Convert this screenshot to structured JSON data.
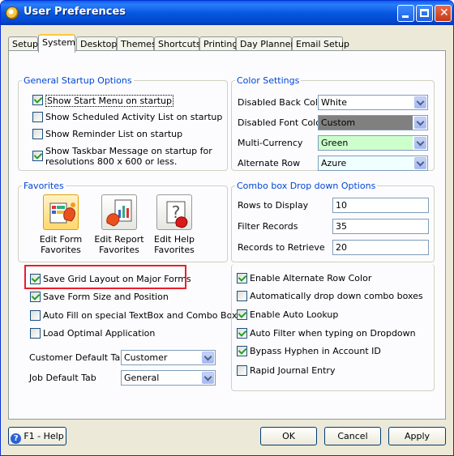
{
  "window": {
    "title": "User Preferences"
  },
  "tabs": [
    "Setup",
    "System",
    "Desktop",
    "Themes",
    "Shortcuts",
    "Printing",
    "Day Planner",
    "Email Setup"
  ],
  "startup": {
    "legend": "General Startup Options",
    "options": [
      {
        "label": "Show Start Menu on startup",
        "checked": true
      },
      {
        "label": "Show Scheduled Activity List on startup",
        "checked": false
      },
      {
        "label": "Show Reminder List on startup",
        "checked": false
      },
      {
        "label": "Show Taskbar Message on startup for",
        "label2": "resolutions 800 x 600 or less.",
        "checked": true
      }
    ]
  },
  "colors": {
    "legend": "Color Settings",
    "rows": [
      {
        "label": "Disabled Back Color",
        "value": "White",
        "swatch": "#ffffff"
      },
      {
        "label": "Disabled Font Color",
        "value": "Custom",
        "swatch": "#808080"
      },
      {
        "label": "Multi-Currency",
        "value": "Green",
        "swatch": "#ccffcc"
      },
      {
        "label": "Alternate Row",
        "value": "Azure",
        "swatch": "#f0ffff"
      }
    ]
  },
  "favorites": {
    "legend": "Favorites",
    "items": [
      {
        "label1": "Edit Form",
        "label2": "Favorites",
        "icon": "edit-form-favorites-icon"
      },
      {
        "label1": "Edit Report",
        "label2": "Favorites",
        "icon": "edit-report-favorites-icon"
      },
      {
        "label1": "Edit Help",
        "label2": "Favorites",
        "icon": "edit-help-favorites-icon"
      }
    ]
  },
  "combo_options": {
    "legend": "Combo box Drop down Options",
    "rows": [
      {
        "label": "Rows to Display",
        "value": "10"
      },
      {
        "label": "Filter Records",
        "value": "35"
      },
      {
        "label": "Records to Retrieve",
        "value": "20"
      }
    ]
  },
  "left_options": [
    {
      "label": "Save Grid Layout on Major Forms",
      "checked": true
    },
    {
      "label": "Save Form Size and Position",
      "checked": true
    },
    {
      "label": "Auto Fill on special TextBox and Combo Box",
      "checked": false
    },
    {
      "label": "Load Optimal Application",
      "checked": false
    }
  ],
  "default_tabs": [
    {
      "label": "Customer Default Tab",
      "value": "Customer"
    },
    {
      "label": "Job Default Tab",
      "value": "General"
    }
  ],
  "right_options": [
    {
      "label": "Enable Alternate Row Color",
      "checked": true
    },
    {
      "label": "Automatically drop down combo boxes",
      "checked": false
    },
    {
      "label": "Enable Auto Lookup",
      "checked": true
    },
    {
      "label": "Auto Filter when typing on Dropdown",
      "checked": true
    },
    {
      "label": "Bypass Hyphen in Account ID",
      "checked": true
    },
    {
      "label": "Rapid Journal Entry",
      "checked": false
    }
  ],
  "footer": {
    "help": "F1 - Help",
    "ok": "OK",
    "cancel": "Cancel",
    "apply": "Apply"
  },
  "highlight_color": "#e8202a"
}
